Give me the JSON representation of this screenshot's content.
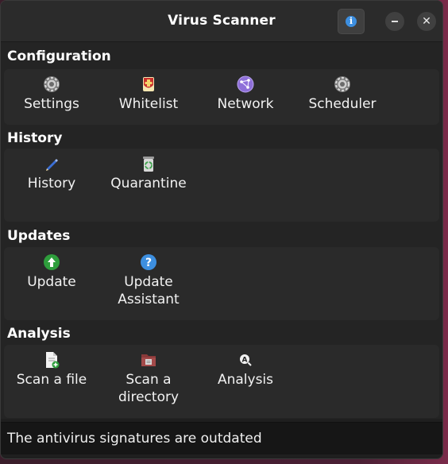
{
  "window": {
    "title": "Virus Scanner"
  },
  "sections": {
    "configuration": {
      "title": "Configuration",
      "items": [
        {
          "label": "Settings",
          "icon": "gear-icon"
        },
        {
          "label": "Whitelist",
          "icon": "shield-icon"
        },
        {
          "label": "Network",
          "icon": "network-icon"
        },
        {
          "label": "Scheduler",
          "icon": "gear-icon"
        }
      ]
    },
    "history": {
      "title": "History",
      "items": [
        {
          "label": "History",
          "icon": "pencil-icon"
        },
        {
          "label": "Quarantine",
          "icon": "recycle-bin-icon"
        }
      ]
    },
    "updates": {
      "title": "Updates",
      "items": [
        {
          "label": "Update",
          "icon": "arrow-up-icon"
        },
        {
          "label": "Update Assistant",
          "line1": "Update",
          "line2": "Assistant",
          "icon": "question-icon"
        }
      ]
    },
    "analysis": {
      "title": "Analysis",
      "items": [
        {
          "label": "Scan a file",
          "icon": "file-add-icon"
        },
        {
          "label": "Scan a directory",
          "line1": "Scan a",
          "line2": "directory",
          "icon": "folder-icon"
        },
        {
          "label": "Analysis",
          "icon": "analysis-icon"
        }
      ]
    }
  },
  "status": {
    "message": "The antivirus signatures are outdated"
  },
  "colors": {
    "accent_blue": "#3d8fe0",
    "update_green": "#2e9e3c",
    "panel_bg": "#2a2a2a",
    "window_bg": "#242424"
  }
}
